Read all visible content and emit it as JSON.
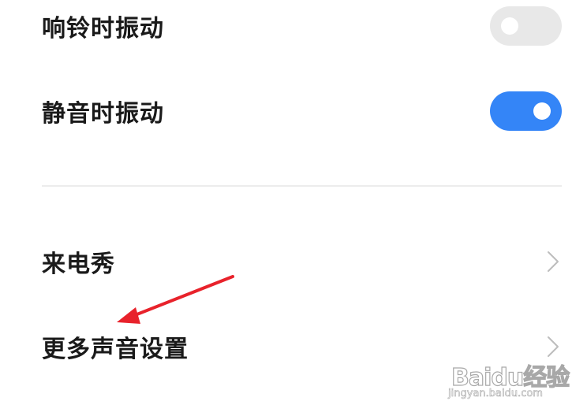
{
  "settings": {
    "vibrate_on_ring": {
      "label": "响铃时振动",
      "enabled": false
    },
    "vibrate_on_silent": {
      "label": "静音时振动",
      "enabled": true
    },
    "caller_show": {
      "label": "来电秀"
    },
    "more_sound_settings": {
      "label": "更多声音设置"
    }
  },
  "icons": {
    "chevron": "chevron-right-icon",
    "annotation": "red-arrow-icon"
  },
  "colors": {
    "toggle_on": "#3485f7",
    "toggle_off": "#e8e8e8",
    "chevron": "#bdbdbd",
    "annotation_arrow": "#e8222b"
  },
  "watermark": {
    "brand": "Baidu经验",
    "url": "jingyan.baidu.com"
  }
}
